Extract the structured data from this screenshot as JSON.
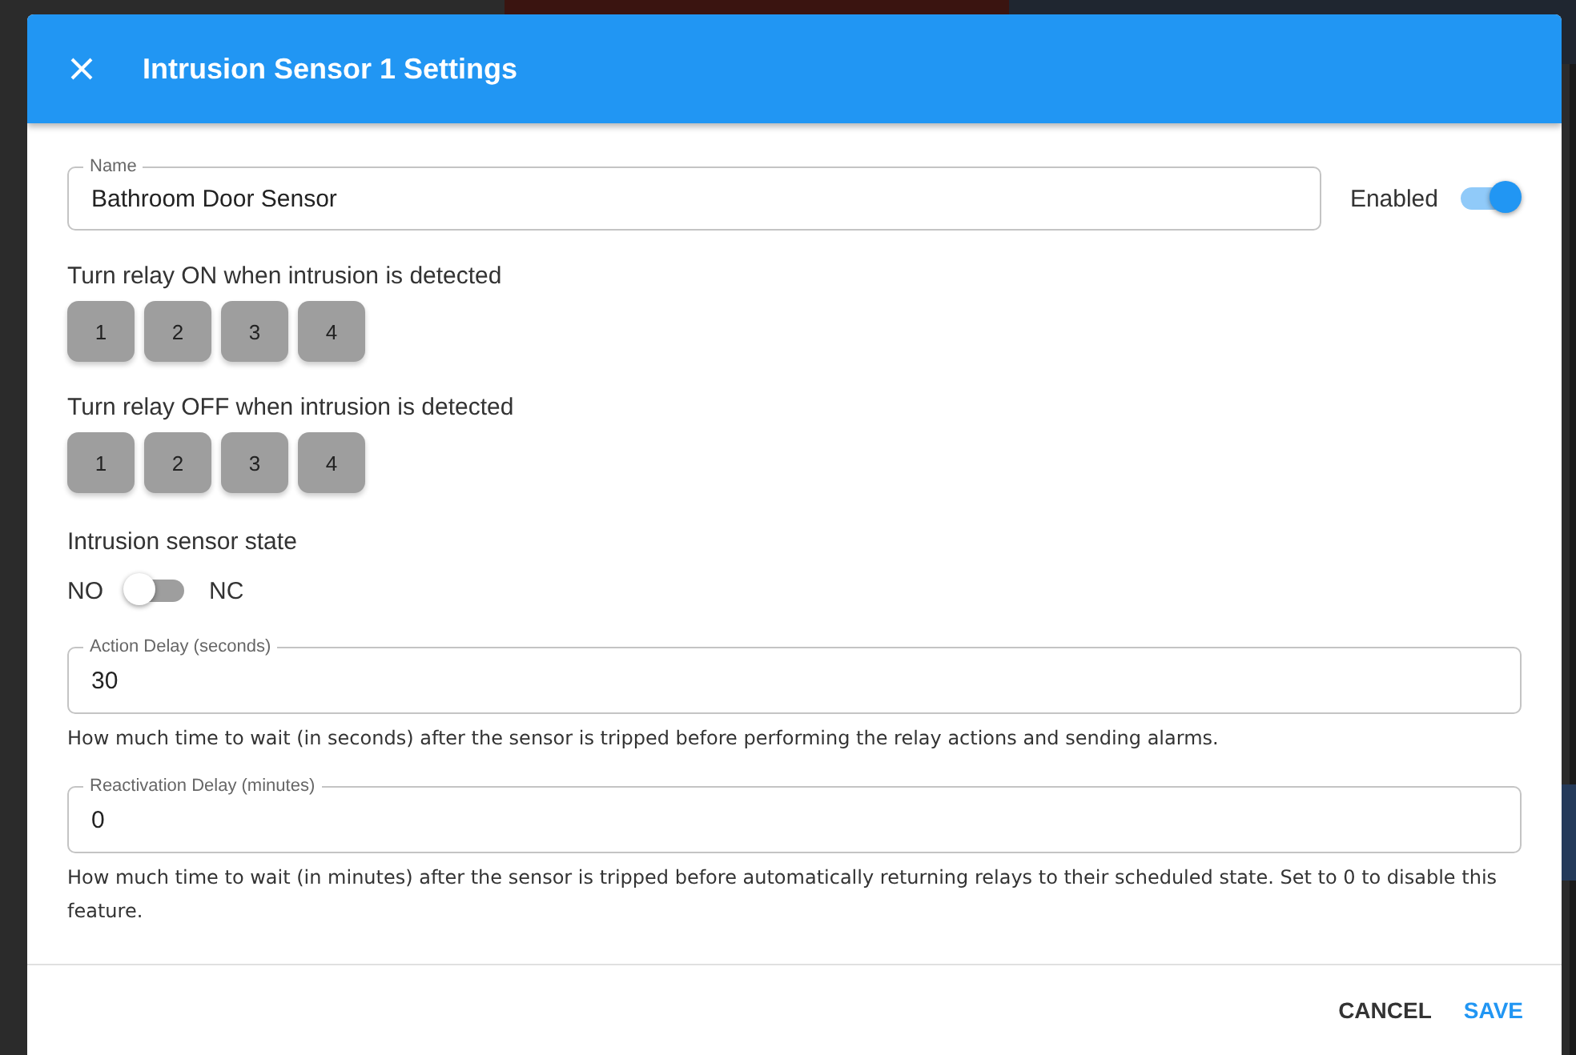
{
  "dialog": {
    "title": "Intrusion Sensor 1 Settings"
  },
  "name_field": {
    "label": "Name",
    "value": "Bathroom Door Sensor"
  },
  "enabled": {
    "label": "Enabled",
    "on": true
  },
  "relay_groups": [
    {
      "label": "Turn relay ON when intrusion is detected",
      "relays": [
        {
          "label": "1",
          "selected": false
        },
        {
          "label": "2",
          "selected": false
        },
        {
          "label": "3",
          "selected": false
        },
        {
          "label": "4",
          "selected": false
        }
      ]
    },
    {
      "label": "Turn relay OFF when intrusion is detected",
      "relays": [
        {
          "label": "1",
          "selected": false
        },
        {
          "label": "2",
          "selected": false
        },
        {
          "label": "3",
          "selected": false
        },
        {
          "label": "4",
          "selected": false
        }
      ]
    }
  ],
  "sensor_state": {
    "label": "Intrusion sensor state",
    "left": "NO",
    "right": "NC",
    "on": false
  },
  "delay_fields": [
    {
      "label": "Action Delay (seconds)",
      "value": "30",
      "hint": "How much time to wait (in seconds) after the sensor is tripped before performing the relay actions and sending alarms."
    },
    {
      "label": "Reactivation Delay (minutes)",
      "value": "0",
      "hint": "How much time to wait (in minutes) after the sensor is tripped before automatically returning relays to their scheduled state. Set to 0 to disable this feature."
    }
  ],
  "actions": [
    {
      "label": "CANCEL",
      "kind": "secondary"
    },
    {
      "label": "SAVE",
      "kind": "primary"
    }
  ]
}
